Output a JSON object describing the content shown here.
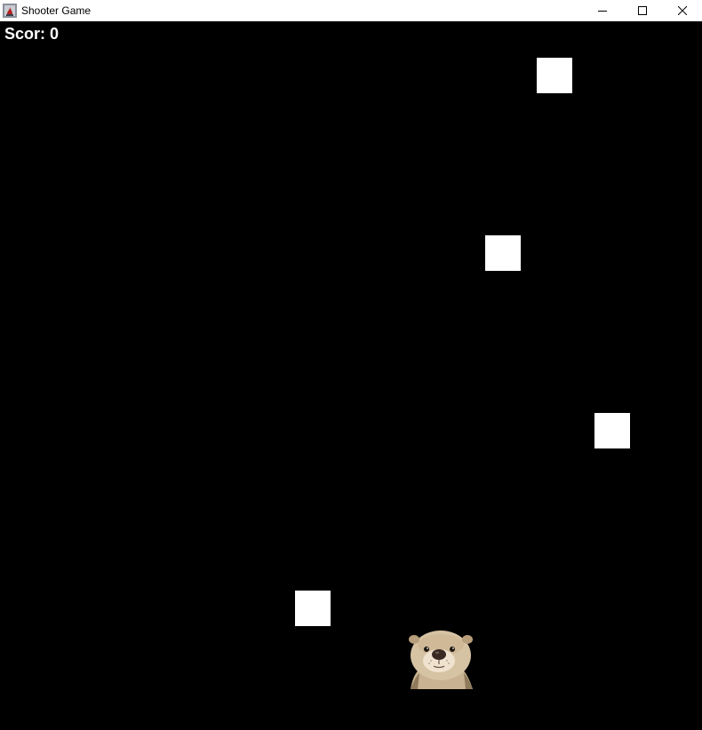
{
  "window": {
    "title": "Shooter Game",
    "controls": {
      "minimize_icon": "minimize-icon",
      "maximize_icon": "maximize-icon",
      "close_icon": "close-icon"
    }
  },
  "hud": {
    "score_label": "Scor:",
    "score_value": "0"
  },
  "game": {
    "background_color": "#000000",
    "enemy_color": "#ffffff",
    "enemy_count": 4,
    "player_sprite": "otter"
  }
}
